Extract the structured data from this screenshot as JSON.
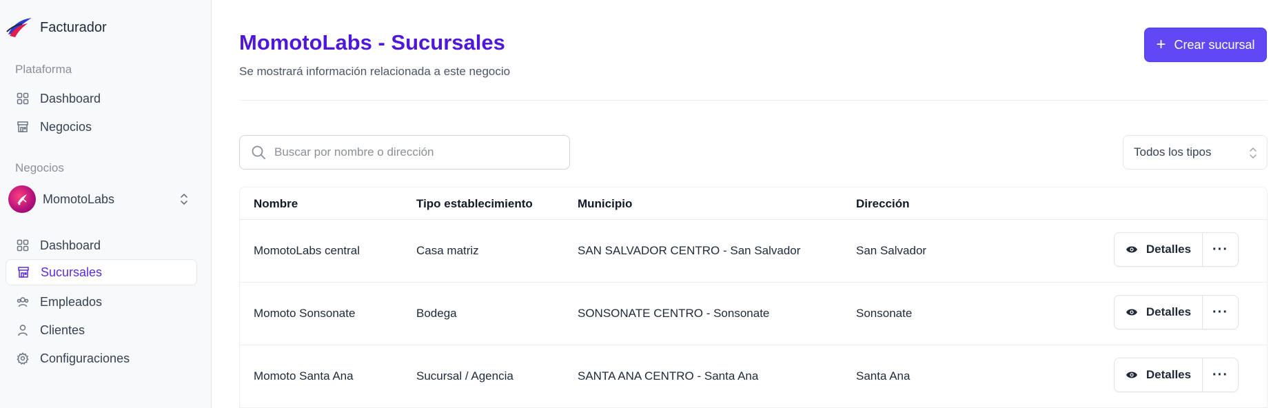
{
  "app": {
    "name": "Facturador"
  },
  "sidebar": {
    "platform_label": "Plataforma",
    "platform_items": [
      {
        "label": "Dashboard",
        "icon": "grid-icon"
      },
      {
        "label": "Negocios",
        "icon": "store-icon"
      }
    ],
    "business_label": "Negocios",
    "business_switcher": {
      "name": "MomotoLabs",
      "icon": "chevrons-up-down-icon"
    },
    "business_items": [
      {
        "label": "Dashboard",
        "icon": "grid-icon",
        "active": false
      },
      {
        "label": "Sucursales",
        "icon": "store-icon",
        "active": true
      },
      {
        "label": "Empleados",
        "icon": "users-icon",
        "active": false
      },
      {
        "label": "Clientes",
        "icon": "user-icon",
        "active": false
      },
      {
        "label": "Configuraciones",
        "icon": "gear-icon",
        "active": false
      }
    ]
  },
  "header": {
    "title": "MomotoLabs - Sucursales",
    "subtitle": "Se mostrará información relacionada a este negocio",
    "create_button": "Crear sucursal"
  },
  "filters": {
    "search_placeholder": "Buscar por nombre o dirección",
    "type_select": "Todos los tipos"
  },
  "table": {
    "columns": [
      "Nombre",
      "Tipo establecimiento",
      "Municipio",
      "Dirección"
    ],
    "rows": [
      {
        "nombre": "MomotoLabs central",
        "tipo": "Casa matriz",
        "municipio": "SAN SALVADOR CENTRO - San Salvador",
        "direccion": "San Salvador"
      },
      {
        "nombre": "Momoto Sonsonate",
        "tipo": "Bodega",
        "municipio": "SONSONATE CENTRO - Sonsonate",
        "direccion": "Sonsonate"
      },
      {
        "nombre": "Momoto Santa Ana",
        "tipo": "Sucursal / Agencia",
        "municipio": "SANTA ANA CENTRO - Santa Ana",
        "direccion": "Santa Ana"
      }
    ],
    "details_label": "Detalles",
    "more_label": "···"
  },
  "colors": {
    "accent": "#6148f5",
    "title": "#4f17d8",
    "active_nav": "#5b2be0"
  }
}
